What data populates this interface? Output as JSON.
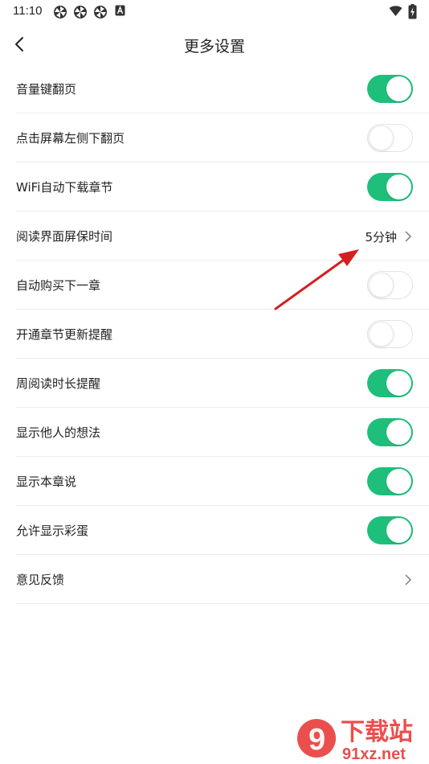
{
  "status_bar": {
    "time": "11:10",
    "icons": [
      "pinwheel-icon",
      "pinwheel-icon",
      "pinwheel-icon",
      "a-badge-icon"
    ],
    "right_icons": [
      "wifi-icon",
      "battery-charging-icon"
    ]
  },
  "header": {
    "back_icon": "chevron-left-icon",
    "title": "更多设置"
  },
  "settings": [
    {
      "label": "音量键翻页",
      "type": "toggle",
      "on": true
    },
    {
      "label": "点击屏幕左侧下翻页",
      "type": "toggle",
      "on": false
    },
    {
      "label": "WiFi自动下载章节",
      "type": "toggle",
      "on": true
    },
    {
      "label": "阅读界面屏保时间",
      "type": "link",
      "value": "5分钟"
    },
    {
      "label": "自动购买下一章",
      "type": "toggle",
      "on": false
    },
    {
      "label": "开通章节更新提醒",
      "type": "toggle",
      "on": false
    },
    {
      "label": "周阅读时长提醒",
      "type": "toggle",
      "on": true
    },
    {
      "label": "显示他人的想法",
      "type": "toggle",
      "on": true
    },
    {
      "label": "显示本章说",
      "type": "toggle",
      "on": true
    },
    {
      "label": "允许显示彩蛋",
      "type": "toggle",
      "on": true
    },
    {
      "label": "意见反馈",
      "type": "link",
      "value": ""
    }
  ],
  "colors": {
    "toggle_on": "#1dbf7b",
    "arrow": "#e02424",
    "watermark": "#e8302e"
  },
  "watermark": {
    "brand": "下载站",
    "domain": "91xz.net",
    "logo_text": "9"
  }
}
